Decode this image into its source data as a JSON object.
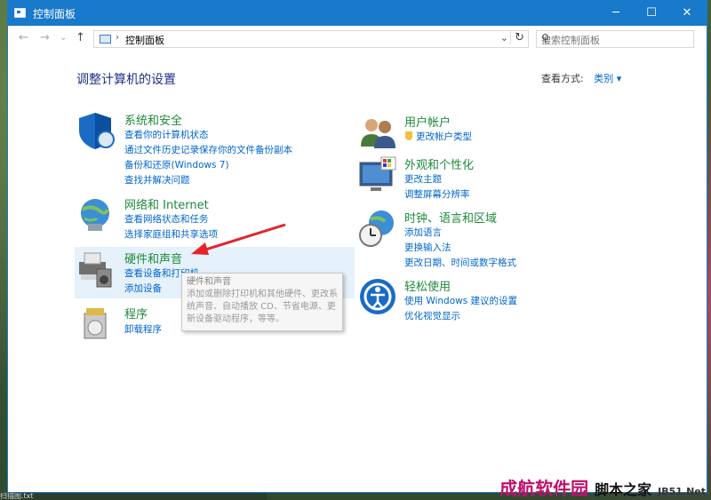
{
  "window": {
    "title": "控制面板",
    "controls": {
      "minimize": "─",
      "maximize": "☐",
      "close": "✕"
    }
  },
  "address": {
    "path": "控制面板",
    "search_placeholder": "搜索控制面板"
  },
  "header": {
    "title": "调整计算机的设置",
    "view_label": "查看方式:",
    "view_value": "类别 ▾"
  },
  "categories": [
    {
      "title": "系统和安全",
      "links": [
        "查看你的计算机状态",
        "通过文件历史记录保存你的文件备份副本",
        "备份和还原(Windows 7)",
        "查找并解决问题"
      ]
    },
    {
      "title": "网络和 Internet",
      "links": [
        "查看网络状态和任务",
        "选择家庭组和共享选项"
      ]
    },
    {
      "title": "硬件和声音",
      "links": [
        "查看设备和打印机",
        "添加设备"
      ]
    },
    {
      "title": "程序",
      "links": [
        "卸载程序"
      ]
    },
    {
      "title": "用户帐户",
      "links": [
        "更改帐户类型"
      ]
    },
    {
      "title": "外观和个性化",
      "links": [
        "更改主题",
        "调整屏幕分辨率"
      ]
    },
    {
      "title": "时钟、语言和区域",
      "links": [
        "添加语言",
        "更换输入法",
        "更改日期、时间或数字格式"
      ]
    },
    {
      "title": "轻松使用",
      "links": [
        "使用 Windows 建议的设置",
        "优化视觉显示"
      ]
    }
  ],
  "tooltip": {
    "title": "硬件和声音",
    "body": "添加或删除打印机和其他硬件、更改系统声音、自动播放 CD、节省电源、更新设备驱动程序，等等。"
  },
  "watermark": {
    "line1": "成航软件园",
    "line2": "脚本之家",
    "line3": "JB51.Net"
  },
  "taskbar": {
    "text": "扫描图.txt"
  }
}
